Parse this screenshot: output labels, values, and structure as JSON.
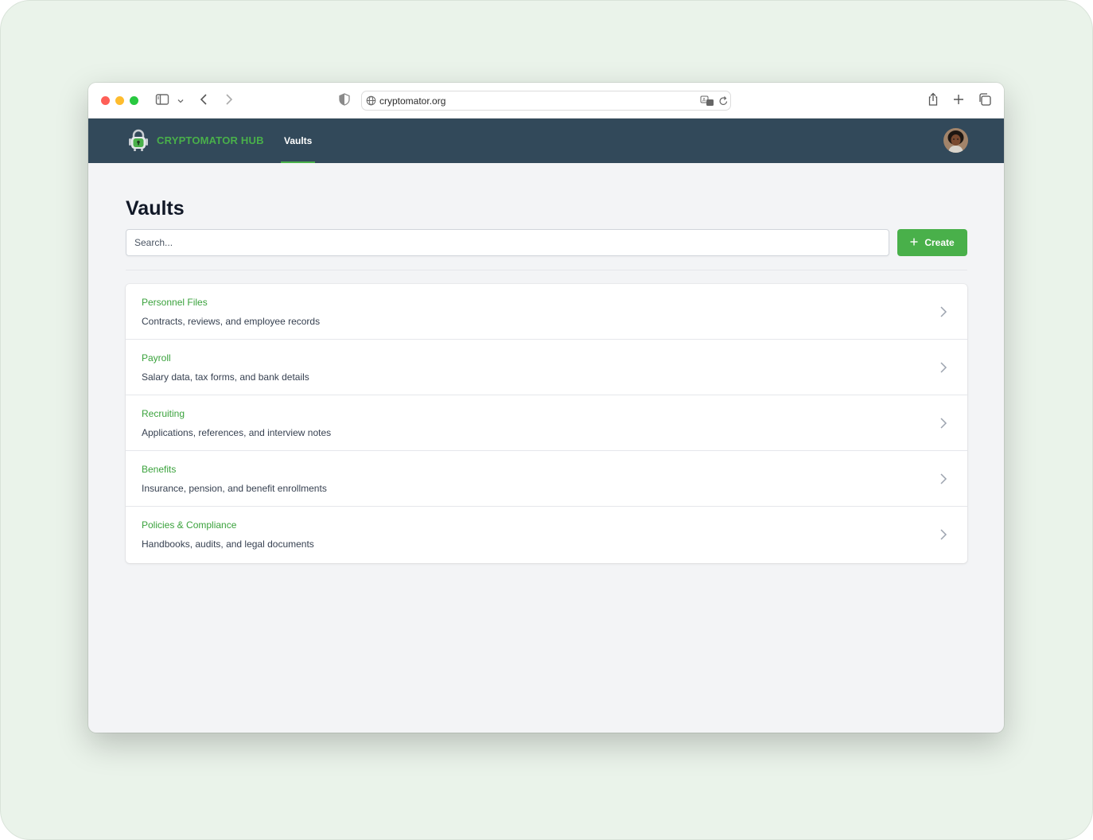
{
  "browser": {
    "url": "cryptomator.org"
  },
  "navbar": {
    "brand": "CRYPTOMATOR HUB",
    "active_link": "Vaults"
  },
  "page": {
    "title": "Vaults",
    "search_placeholder": "Search...",
    "create_label": "Create"
  },
  "vaults": [
    {
      "name": "Personnel Files",
      "description": "Contracts, reviews, and employee records"
    },
    {
      "name": "Payroll",
      "description": "Salary data, tax forms, and bank details"
    },
    {
      "name": "Recruiting",
      "description": "Applications, references, and interview notes"
    },
    {
      "name": "Benefits",
      "description": "Insurance, pension, and benefit enrollments"
    },
    {
      "name": "Policies & Compliance",
      "description": "Handbooks, audits, and legal documents"
    }
  ],
  "colors": {
    "accent_green": "#49b04a",
    "navbar_bg": "#32495a",
    "page_bg": "#f3f4f6"
  }
}
